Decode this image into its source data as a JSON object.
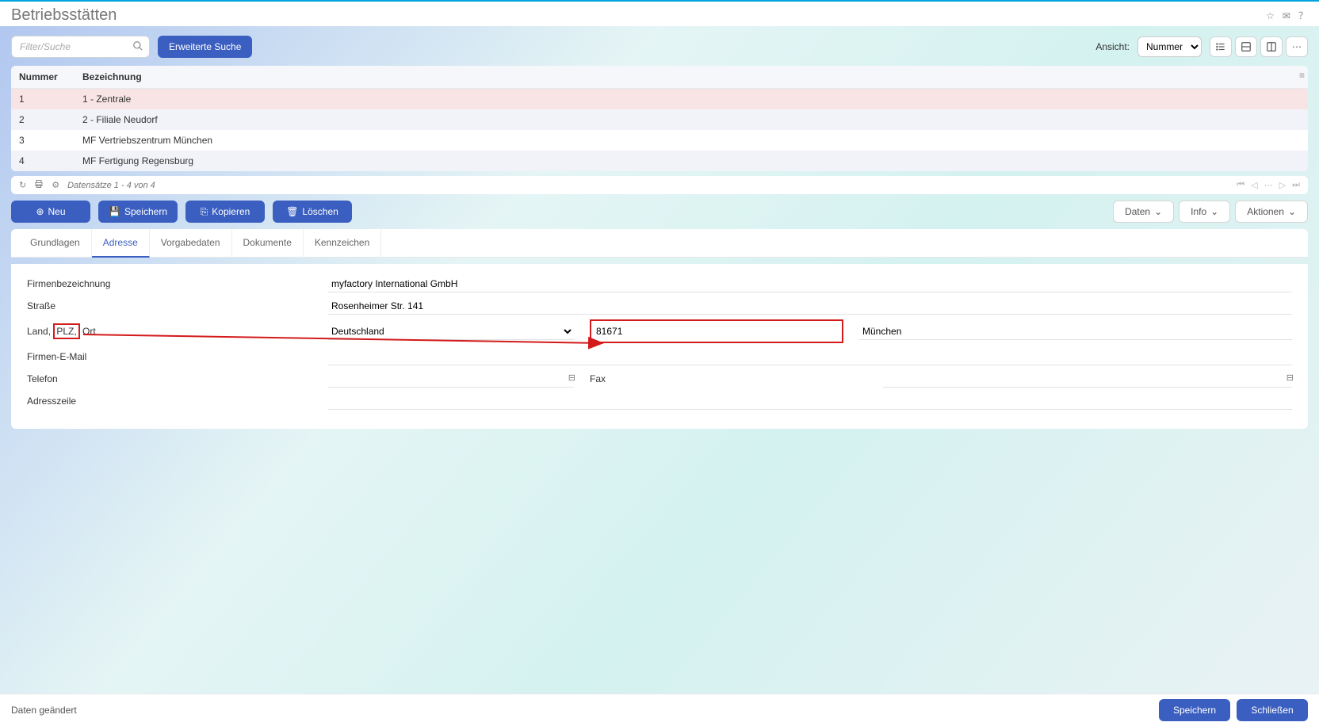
{
  "header": {
    "title": "Betriebsstätten"
  },
  "toolbar": {
    "search_placeholder": "Filter/Suche",
    "ext_search": "Erweiterte Suche",
    "ansicht_label": "Ansicht:",
    "ansicht_value": "Nummer"
  },
  "table": {
    "col_number": "Nummer",
    "col_name": "Bezeichnung",
    "rows": [
      {
        "num": "1",
        "name": "1 - Zentrale"
      },
      {
        "num": "2",
        "name": "2 - Filiale Neudorf"
      },
      {
        "num": "3",
        "name": "MF Vertriebszentrum München"
      },
      {
        "num": "4",
        "name": "MF Fertigung Regensburg"
      }
    ],
    "footer_text": "Datensätze 1 - 4 von 4"
  },
  "actions": {
    "new": "Neu",
    "save": "Speichern",
    "copy": "Kopieren",
    "delete": "Löschen",
    "daten": "Daten",
    "info": "Info",
    "aktionen": "Aktionen"
  },
  "tabs": {
    "grundlagen": "Grundlagen",
    "adresse": "Adresse",
    "vorgabedaten": "Vorgabedaten",
    "dokumente": "Dokumente",
    "kennzeichen": "Kennzeichen"
  },
  "form": {
    "label_firma": "Firmenbezeichnung",
    "val_firma": "myfactory International GmbH",
    "label_strasse": "Straße",
    "val_strasse": "Rosenheimer Str. 141",
    "label_landplzort": "Land, PLZ, Ort",
    "label_plz_highlight": "PLZ,",
    "val_land": "Deutschland",
    "val_plz": "81671",
    "val_ort": "München",
    "label_email": "Firmen-E-Mail",
    "val_email": "",
    "label_telefon": "Telefon",
    "val_telefon": "",
    "label_fax": "Fax",
    "val_fax": "",
    "label_adresszeile": "Adresszeile",
    "val_adresszeile": ""
  },
  "status": {
    "changed": "Daten geändert",
    "save": "Speichern",
    "close": "Schließen"
  }
}
